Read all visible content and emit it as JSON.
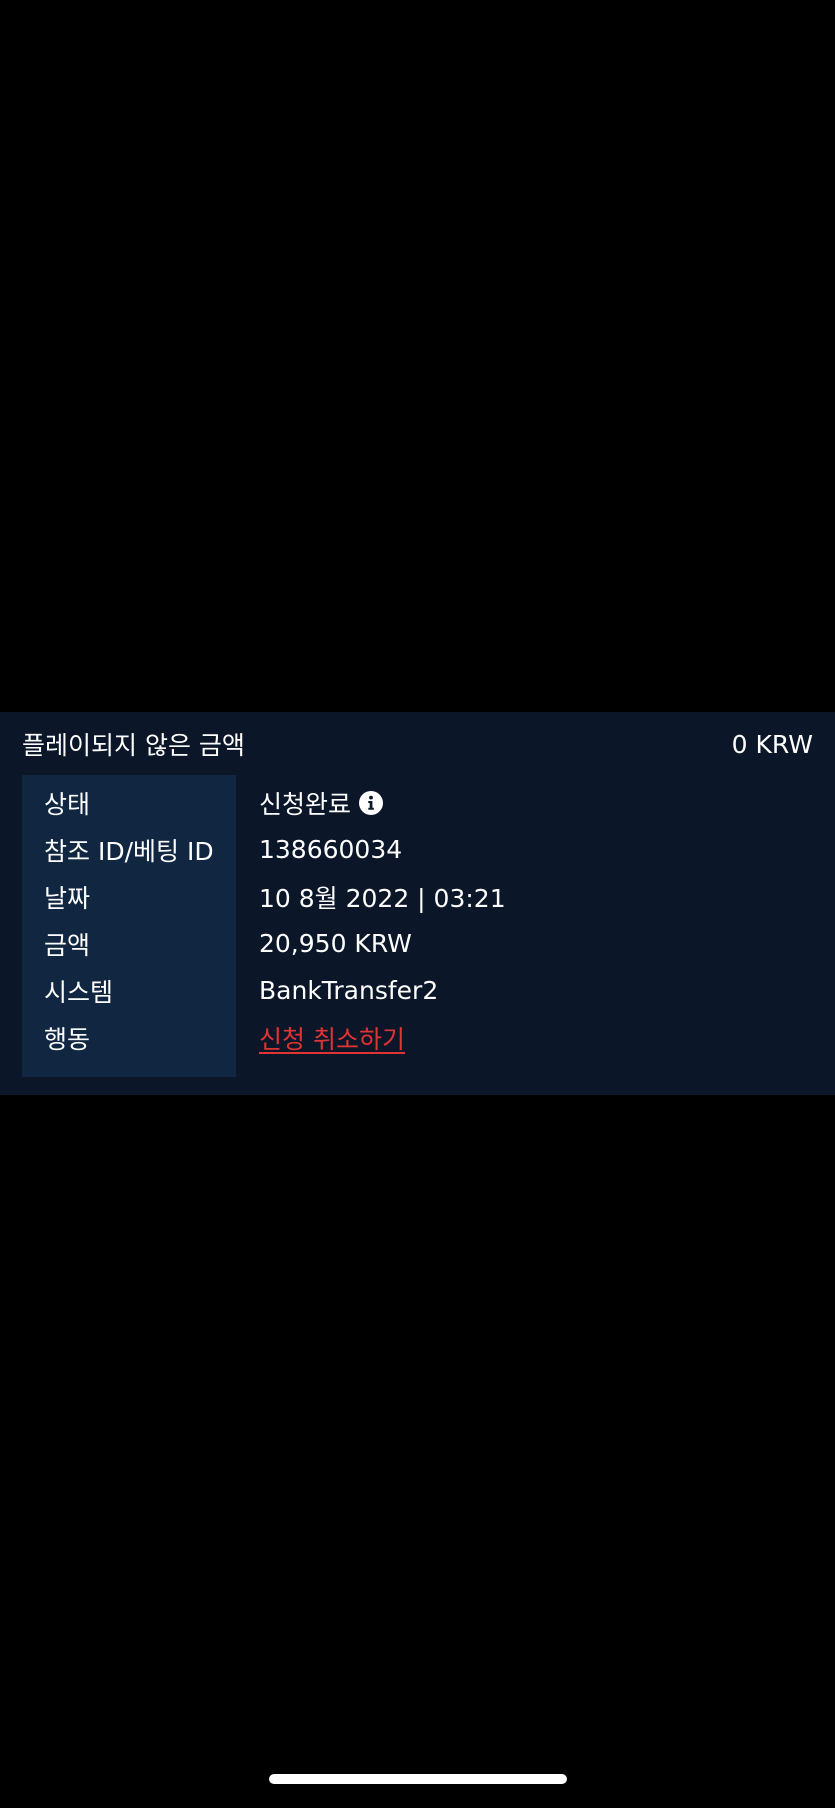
{
  "header": {
    "label": "플레이되지 않은 금액",
    "amount": "0 KRW"
  },
  "details": {
    "rows": [
      {
        "label": "상태",
        "value": "신청완료"
      },
      {
        "label": "참조 ID/베팅 ID",
        "value": "138660034"
      },
      {
        "label": "날짜",
        "value": "10 8월 2022 | 03:21"
      },
      {
        "label": "금액",
        "value": "20,950 KRW"
      },
      {
        "label": "시스템",
        "value": "BankTransfer2"
      },
      {
        "label": "행동",
        "value": "신청 취소하기"
      }
    ]
  },
  "icons": {
    "status_info": "info-icon"
  },
  "colors": {
    "page_background": "#000000",
    "panel_background": "#0b1628",
    "label_column_background": "#102641",
    "text": "#ffffff",
    "cancel_link": "#e03333"
  }
}
